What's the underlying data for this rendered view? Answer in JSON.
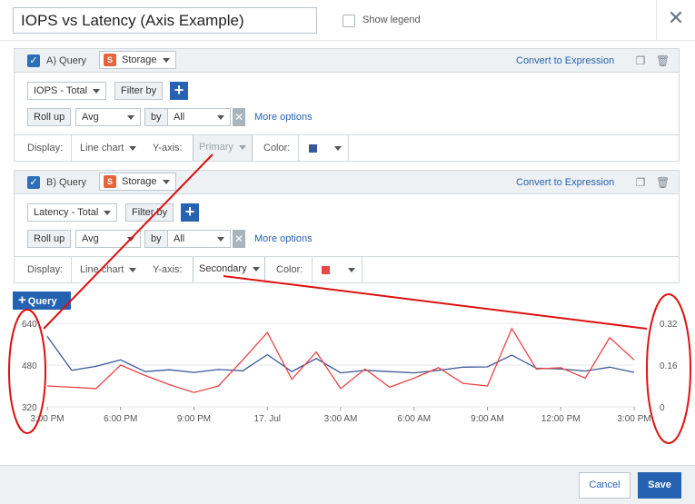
{
  "header": {
    "title_value": "IOPS vs Latency (Axis Example)",
    "show_legend_label": "Show legend",
    "close_icon": "close-icon"
  },
  "queries": [
    {
      "label": "A) Query",
      "source": "Storage",
      "convert_link": "Convert to Expression",
      "metric": "IOPS - Total",
      "filter_by": "Filter by",
      "roll_up": "Roll up",
      "roll_up_fn": "Avg",
      "by_label": "by",
      "by_value": "All",
      "more_options": "More options",
      "display_label": "Display:",
      "chart_type": "Line chart",
      "yaxis_label": "Y-axis:",
      "yaxis_value": "Primary",
      "color_label": "Color:",
      "color": "#3b5998"
    },
    {
      "label": "B) Query",
      "source": "Storage",
      "convert_link": "Convert to Expression",
      "metric": "Latency - Total",
      "filter_by": "Filter by",
      "roll_up": "Roll up",
      "roll_up_fn": "Avg",
      "by_label": "by",
      "by_value": "All",
      "more_options": "More options",
      "display_label": "Display:",
      "chart_type": "Line chart",
      "yaxis_label": "Y-axis:",
      "yaxis_value": "Secondary",
      "color_label": "Color:",
      "color": "#ee4444"
    }
  ],
  "add_query_label": "Query",
  "footer": {
    "cancel_label": "Cancel",
    "save_label": "Save"
  },
  "chart_data": {
    "type": "line",
    "x_ticks": [
      "3:00 PM",
      "6:00 PM",
      "9:00 PM",
      "17. Jul",
      "3:00 AM",
      "6:00 AM",
      "9:00 AM",
      "12:00 PM",
      "3:00 PM"
    ],
    "y_left_ticks": [
      "640",
      "480",
      "320"
    ],
    "y_left_lim": [
      320,
      640
    ],
    "y_right_ticks": [
      "0.32",
      "0.16",
      "0"
    ],
    "y_right_lim": [
      0,
      0.32
    ],
    "grid": true,
    "series": [
      {
        "axis": "primary",
        "color": "#3b5998",
        "values": [
          590,
          460,
          475,
          500,
          455,
          462,
          452,
          463,
          458,
          520,
          455,
          505,
          450,
          460,
          455,
          450,
          460,
          472,
          473,
          518,
          468,
          465,
          457,
          472,
          452
        ]
      },
      {
        "axis": "secondary",
        "color": "#ee4444",
        "values": [
          0.08,
          0.075,
          0.07,
          0.16,
          0.12,
          0.085,
          0.055,
          0.08,
          0.18,
          0.285,
          0.105,
          0.21,
          0.07,
          0.145,
          0.075,
          0.11,
          0.15,
          0.09,
          0.08,
          0.3,
          0.145,
          0.15,
          0.11,
          0.265,
          0.18
        ]
      }
    ]
  }
}
